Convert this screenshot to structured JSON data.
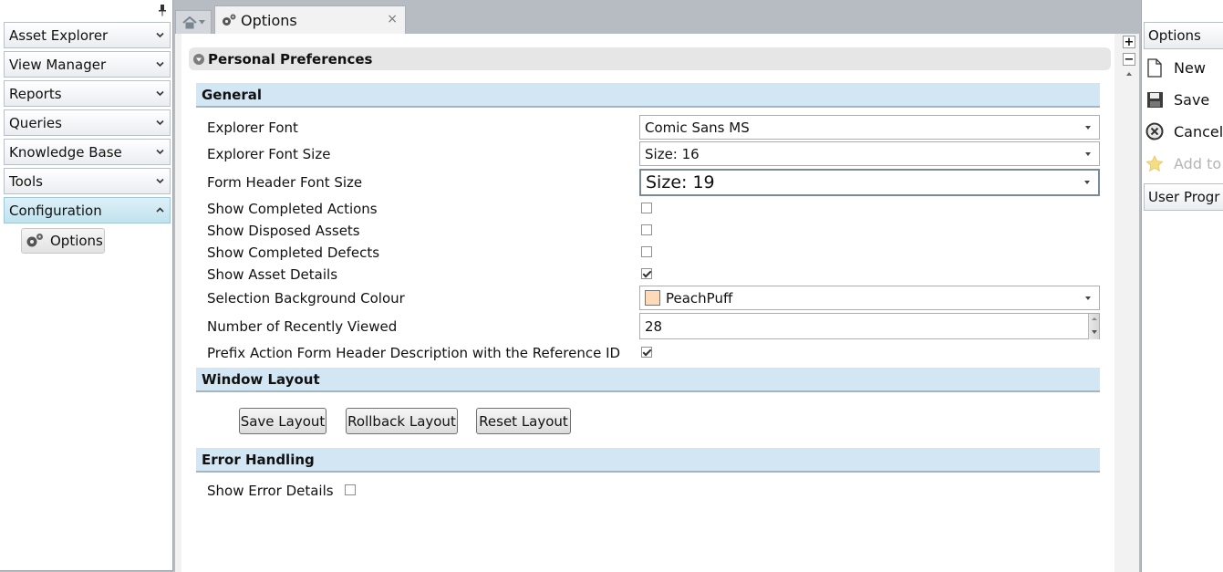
{
  "nav": {
    "items": [
      {
        "label": "Asset Explorer"
      },
      {
        "label": "View Manager"
      },
      {
        "label": "Reports"
      },
      {
        "label": "Queries"
      },
      {
        "label": "Knowledge Base"
      },
      {
        "label": "Tools"
      },
      {
        "label": "Configuration"
      }
    ],
    "sub_item": {
      "label": "Options"
    }
  },
  "tabs": {
    "active": {
      "label": "Options",
      "close": "×"
    }
  },
  "preferences": {
    "title": "Personal Preferences",
    "general": {
      "header": "General",
      "explorer_font": {
        "label": "Explorer Font",
        "value": "Comic Sans MS"
      },
      "explorer_font_size": {
        "label": "Explorer Font Size",
        "value": "Size: 16"
      },
      "form_header_font_size": {
        "label": "Form Header Font Size",
        "value": "Size: 19"
      },
      "show_completed_actions": {
        "label": "Show Completed Actions",
        "checked": false
      },
      "show_disposed_assets": {
        "label": "Show Disposed Assets",
        "checked": false
      },
      "show_completed_defects": {
        "label": "Show Completed Defects",
        "checked": false
      },
      "show_asset_details": {
        "label": "Show Asset Details",
        "checked": true
      },
      "selection_background_colour": {
        "label": "Selection Background Colour",
        "value": "PeachPuff",
        "swatch": "#FFDAB9"
      },
      "recently_viewed": {
        "label": "Number of Recently Viewed",
        "value": "28"
      },
      "prefix_reference": {
        "label": "Prefix Action Form Header Description with the Reference ID",
        "checked": true
      }
    },
    "window_layout": {
      "header": "Window Layout",
      "save_label": "Save Layout",
      "rollback_label": "Rollback Layout",
      "reset_label": "Reset Layout"
    },
    "error_handling": {
      "header": "Error Handling",
      "show_error_details": {
        "label": "Show Error Details",
        "checked": false
      }
    }
  },
  "zoom": {
    "plus": "+",
    "minus": "−"
  },
  "actions": {
    "header": "Options",
    "new": "New",
    "save": "Save",
    "cancel": "Cancel",
    "add_to": "Add to",
    "user_progress": "User Progr"
  },
  "colors": {
    "section_header": "#d3e6f3",
    "nav_active": "#bfe2ee",
    "swatch": "#FFDAB9"
  }
}
